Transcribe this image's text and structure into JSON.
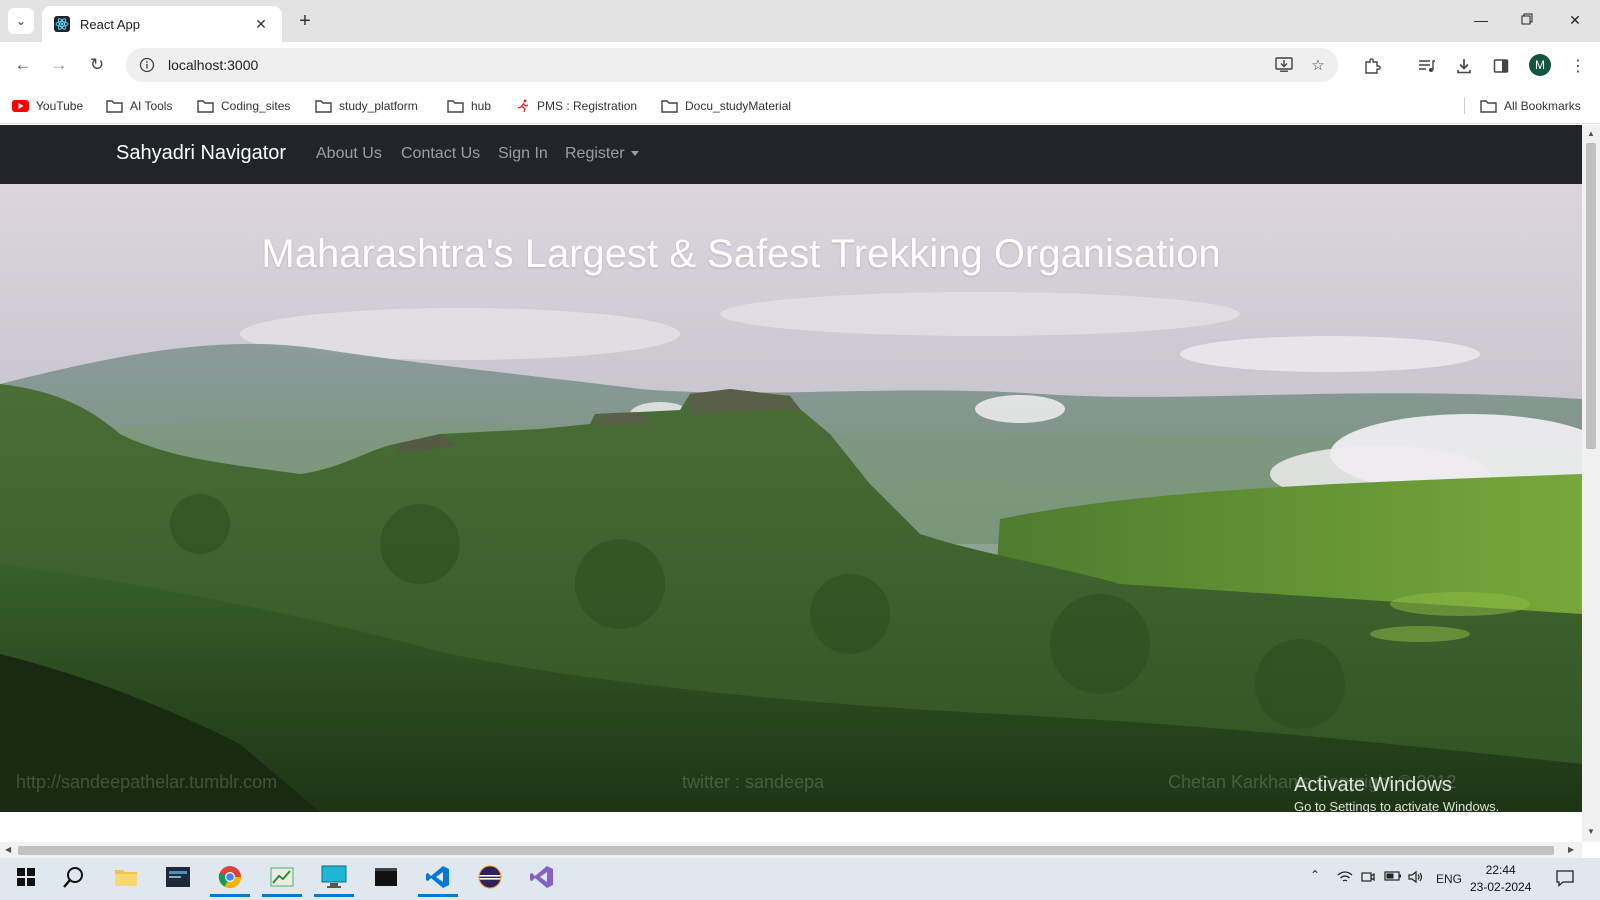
{
  "browser": {
    "tab_title": "React App",
    "url": "localhost:3000",
    "avatar_letter": "M"
  },
  "bookmarks": [
    {
      "label": "YouTube",
      "icon": "youtube-icon"
    },
    {
      "label": "AI Tools",
      "icon": "folder-icon"
    },
    {
      "label": "Coding_sites",
      "icon": "folder-icon"
    },
    {
      "label": "study_platform",
      "icon": "folder-icon"
    },
    {
      "label": "hub",
      "icon": "folder-icon"
    },
    {
      "label": "PMS : Registration",
      "icon": "runner-icon"
    },
    {
      "label": "Docu_studyMaterial",
      "icon": "folder-icon"
    }
  ],
  "all_bookmarks": "All Bookmarks",
  "navbar": {
    "brand": "Sahyadri Navigator",
    "links": [
      "About Us",
      "Contact Us",
      "Sign In"
    ],
    "dropdown": "Register"
  },
  "hero": {
    "title": "Maharashtra's Largest & Safest Trekking Organisation",
    "watermarks": [
      "http://sandeepathelar.tumblr.com",
      "twitter : sandeepa",
      "Chetan Karkhanis Copyright © 2012"
    ]
  },
  "os_watermark": {
    "line1": "Activate Windows",
    "line2": "Go to Settings to activate Windows."
  },
  "taskbar": {
    "language": "ENG",
    "time": "22:44",
    "date": "23-02-2024"
  },
  "colors": {
    "navbar_bg": "#212529",
    "taskbar_bg": "#dfe7ef",
    "accent": "#0078d4"
  }
}
